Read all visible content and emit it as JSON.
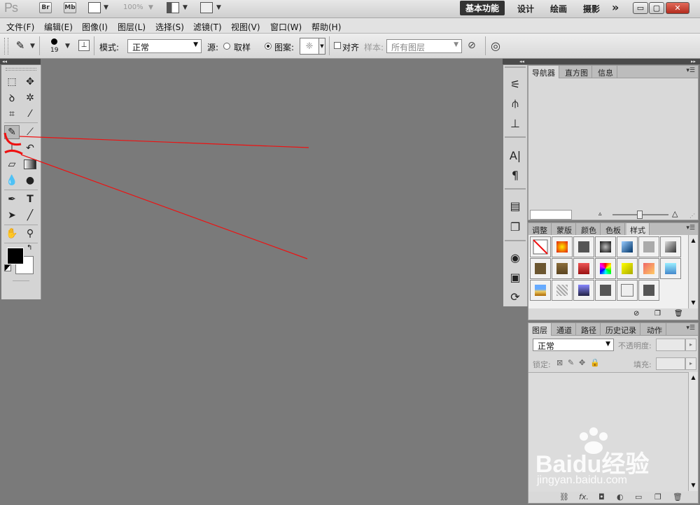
{
  "appbar": {
    "logo": "Ps",
    "br": "Br",
    "mb": "Mb",
    "zoom": "100%",
    "workspaces": [
      "基本功能",
      "设计",
      "绘画",
      "摄影"
    ],
    "more": "»",
    "win_min": "▭",
    "win_max": "▢",
    "win_close": "✕"
  },
  "menubar": {
    "items": [
      "文件(F)",
      "编辑(E)",
      "图像(I)",
      "图层(L)",
      "选择(S)",
      "滤镜(T)",
      "视图(V)",
      "窗口(W)",
      "帮助(H)"
    ]
  },
  "options": {
    "brush_size": "19",
    "mode_label": "模式:",
    "mode_value": "正常",
    "source_label": "源:",
    "sampled_label": "取样",
    "pattern_label": "图案:",
    "aligned_label": "对齐",
    "sample_label": "样本:",
    "sample_value": "所有图层"
  },
  "dock_panels": {
    "top_tabs": [
      "导航器",
      "直方图",
      "信息"
    ],
    "mid_tabs": [
      "调整",
      "蒙版",
      "颜色",
      "色板",
      "样式"
    ],
    "bottom_tabs": [
      "图层",
      "通道",
      "路径",
      "历史记录",
      "动作"
    ],
    "layer_mode": "正常",
    "opacity_label": "不透明度:",
    "lock_label": "锁定:",
    "fill_label": "填充:",
    "layer_footer_fx": "fx."
  },
  "watermark": {
    "brand": "Baidu经验",
    "url": "jingyan.baidu.com"
  },
  "colors": {
    "canvas_bg": "#7a7a7a",
    "annotation": "#e11",
    "fg": "#000000",
    "bg": "#ffffff"
  }
}
